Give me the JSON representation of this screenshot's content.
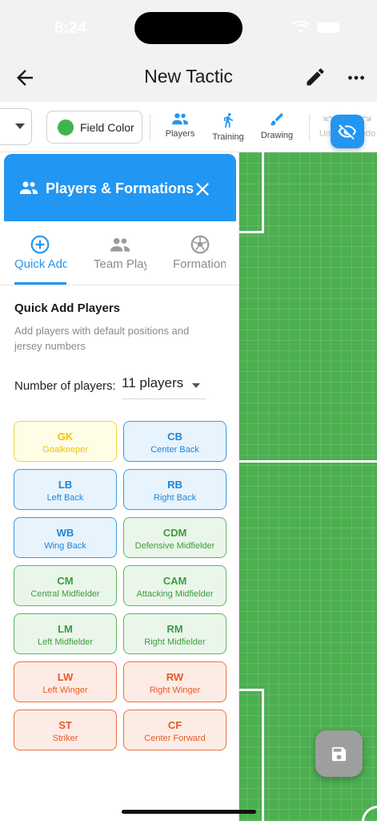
{
  "status_bar": {
    "time": "8:24"
  },
  "app_bar": {
    "title": "New Tactic"
  },
  "toolbar": {
    "field_color_label": "Field Color",
    "field_color": "#3fb34f",
    "players_label": "Players",
    "training_label": "Training",
    "drawing_label": "Drawing",
    "undo_label": "Undo",
    "redo_label": "Redo"
  },
  "panel": {
    "title": "Players & Formations",
    "tabs": [
      {
        "label": "Quick Add",
        "icon": "plus-circle-icon",
        "active": true
      },
      {
        "label": "Team Players",
        "icon": "people-icon",
        "active": false
      },
      {
        "label": "Formations",
        "icon": "soccer-ball-icon",
        "active": false
      }
    ],
    "section_title": "Quick Add Players",
    "section_desc": "Add players with default positions and jersey numbers",
    "number_label": "Number of players:",
    "number_value": "11 players",
    "positions": [
      {
        "code": "GK",
        "name": "Goalkeeper",
        "group": "gk"
      },
      {
        "code": "CB",
        "name": "Center Back",
        "group": "def"
      },
      {
        "code": "LB",
        "name": "Left Back",
        "group": "def"
      },
      {
        "code": "RB",
        "name": "Right Back",
        "group": "def"
      },
      {
        "code": "WB",
        "name": "Wing Back",
        "group": "def"
      },
      {
        "code": "CDM",
        "name": "Defensive Midfielder",
        "group": "mid"
      },
      {
        "code": "CM",
        "name": "Central Midfielder",
        "group": "mid"
      },
      {
        "code": "CAM",
        "name": "Attacking Midfielder",
        "group": "mid"
      },
      {
        "code": "LM",
        "name": "Left Midfielder",
        "group": "mid"
      },
      {
        "code": "RM",
        "name": "Right Midfielder",
        "group": "mid"
      },
      {
        "code": "LW",
        "name": "Left Winger",
        "group": "att"
      },
      {
        "code": "RW",
        "name": "Right Winger",
        "group": "att"
      },
      {
        "code": "ST",
        "name": "Striker",
        "group": "att"
      },
      {
        "code": "CF",
        "name": "Center Forward",
        "group": "att"
      }
    ]
  },
  "colors": {
    "accent": "#2196f3",
    "field_green": "#4caf50",
    "goalkeeper": "#f2c300",
    "defender": "#1f85d6",
    "midfielder": "#3d9b40",
    "attacker": "#e55b25"
  }
}
